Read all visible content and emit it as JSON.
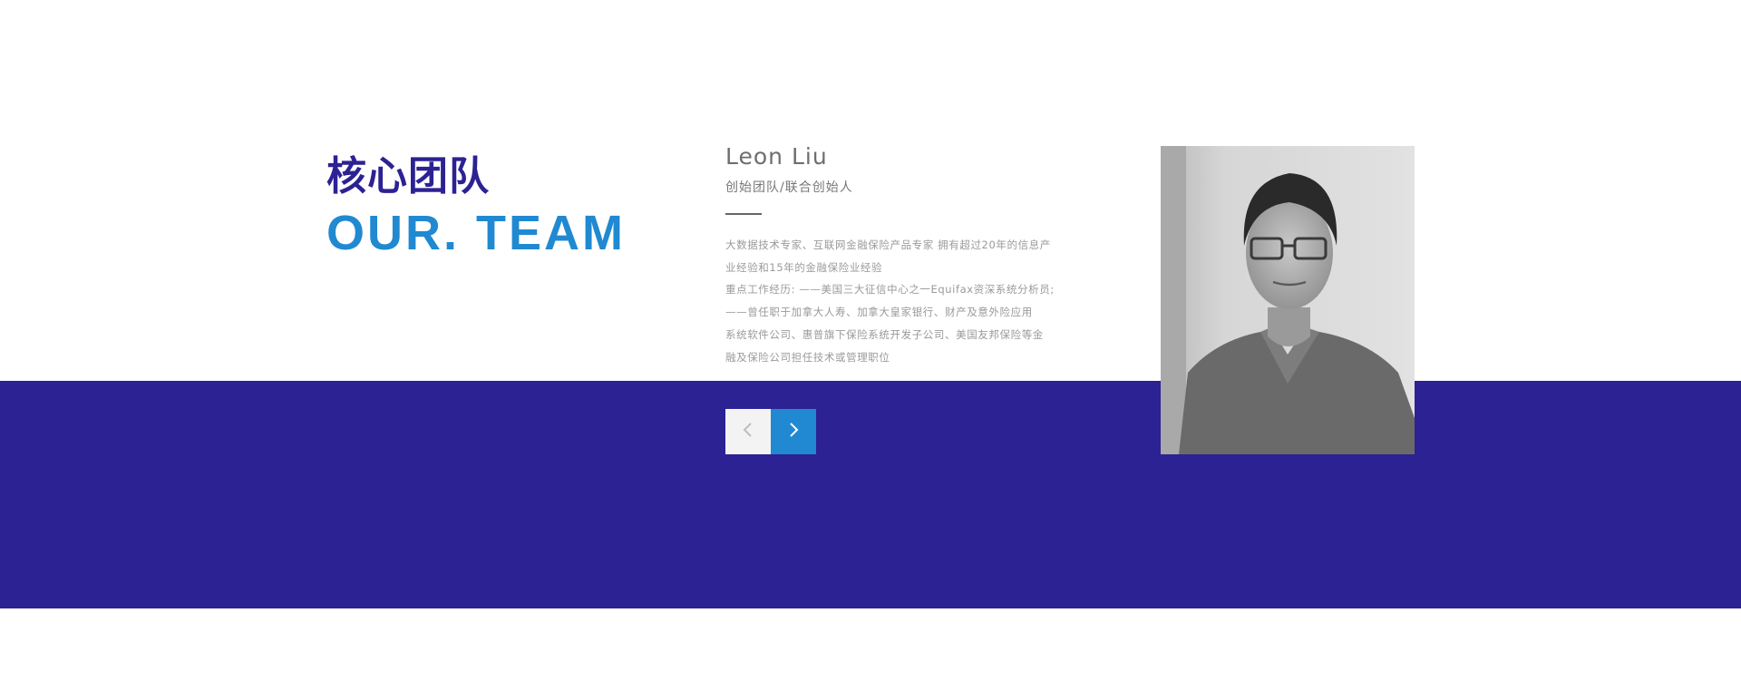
{
  "section": {
    "title_cn": "核心团队",
    "title_en": "OUR. TEAM"
  },
  "member": {
    "name": "Leon Liu",
    "role": "创始团队/联合创始人",
    "bio_lines": [
      "大数据技术专家、互联网金融保险产品专家 拥有超过20年的信息产",
      "业经验和15年的金融保险业经验",
      "重点工作经历: ——美国三大征信中心之一Equifax资深系统分析员;",
      "——曾任职于加拿大人寿、加拿大皇家银行、财产及意外险应用",
      "系统软件公司、惠普旗下保险系统开发子公司、美国友邦保险等金",
      "融及保险公司担任技术或管理职位"
    ]
  },
  "navigation": {
    "prev_icon": "chevron-left-icon",
    "next_icon": "chevron-right-icon"
  },
  "colors": {
    "brand_dark": "#2c2294",
    "brand_accent": "#2089d1",
    "text_gray": "#9a9a9a"
  }
}
